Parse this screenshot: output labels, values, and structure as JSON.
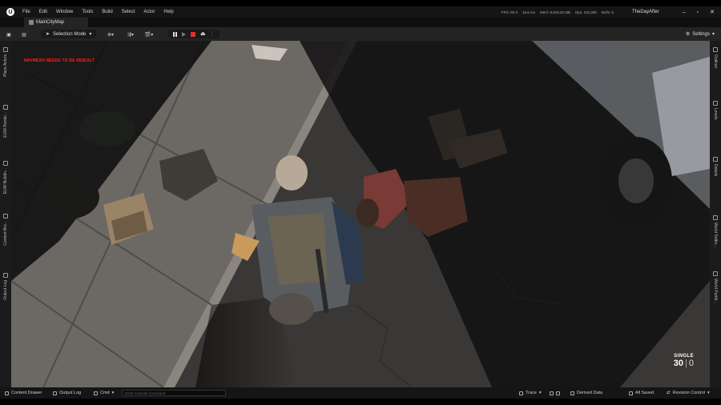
{
  "menu": {
    "items": [
      "File",
      "Edit",
      "Window",
      "Tools",
      "Build",
      "Select",
      "Actor",
      "Help"
    ]
  },
  "stats": {
    "fps": "FPS: 60.3",
    "frame_ms": "16.6 ms",
    "memory": "Mem: 8,919.02 MB",
    "draws": "Dps: 233,280",
    "objects": "Bo/ls: 6"
  },
  "project_name": "TheDayAfter",
  "tab": {
    "label": "MainCityMap"
  },
  "toolbar": {
    "selection_mode": "Selection Mode",
    "settings": "Settings"
  },
  "left_panels": [
    "Place Actors",
    "EUW Randc...",
    "EUW Buildin...",
    "Content Bro...",
    "Output Log"
  ],
  "right_panels": [
    "Outliner",
    "Levels",
    "Details",
    "World Settin...",
    "World Partiti..."
  ],
  "viewport": {
    "warning": "NAVMESH NEEDS TO BE REBUILT",
    "hud_mode": "SINGLE",
    "ammo_loaded": "30",
    "ammo_reserve": "0"
  },
  "statusbar": {
    "content_drawer": "Content Drawer",
    "output_log": "Output Log",
    "cmd": "Cmd",
    "console_placeholder": "Enter Console Command",
    "trace": "Trace",
    "derived_data": "Derived Data",
    "all_saved": "All Saved",
    "revision_control": "Revision Control"
  },
  "colors": {
    "warning": "#ff2020",
    "stop_button": "#e03030",
    "editor_bg": "#242424"
  }
}
